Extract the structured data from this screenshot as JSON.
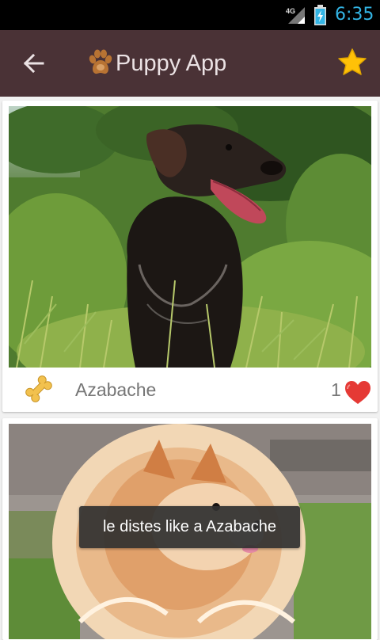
{
  "status_bar": {
    "network_label": "4G",
    "time": "6:35",
    "icons": [
      "signal-icon",
      "battery-charging-icon"
    ]
  },
  "app_bar": {
    "title": "Puppy App",
    "icons": [
      "back-arrow-icon",
      "paw-icon",
      "star-icon"
    ],
    "colors": {
      "background": "#4a3236",
      "title": "#ebe2e4",
      "star": "#ffc107"
    }
  },
  "feed": {
    "items": [
      {
        "name": "Azabache",
        "likes": "1",
        "photo_alt": "dog-photo-black",
        "icons": [
          "bone-icon",
          "heart-icon"
        ]
      },
      {
        "name": "",
        "likes": "",
        "photo_alt": "dog-photo-pomeranian",
        "icons": []
      }
    ]
  },
  "toast": {
    "message": "le distes like a Azabache"
  },
  "colors": {
    "heart": "#e53935",
    "bone": "#f2c14e",
    "status_accent": "#33b5e5"
  }
}
